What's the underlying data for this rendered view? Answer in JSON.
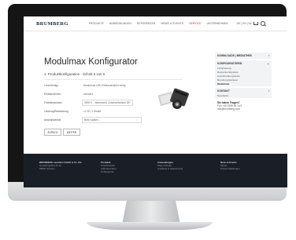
{
  "header": {
    "logo": "BRUMBERG",
    "nav": [
      "PRODUKTE",
      "ANWENDUNGEN",
      "REFERENZEN",
      "NEWS & EVENTS",
      "SERVICE",
      "UNTERNEHMEN"
    ],
    "active_nav": "SERVICE",
    "languages": "DE | EN | NL"
  },
  "page": {
    "title": "Modulmax Konfigurator",
    "step": "1. Produktkonfiguration - Schritt 6 von 6"
  },
  "form": {
    "rows": [
      {
        "label": "Leuchtentyp",
        "value": "Modulmax LED-Einbaustrahler eckig",
        "boxed": false
      },
      {
        "label": "Einbaurahmen",
        "value": "schwarz",
        "boxed": false
      },
      {
        "label": "Farbtemperatur",
        "value": "3000 K - Warmweiß | Abstrahlwinkel 38°",
        "boxed": true
      },
      {
        "label": "Leistung/Bestückung",
        "value": "12 W | 1 Modul",
        "boxed": false
      },
      {
        "label": "Abstrahlwinkel",
        "value": "Bitte wählen...",
        "boxed": true
      }
    ],
    "back_label": "ZURÜCK",
    "next_label": "WEITER"
  },
  "sidebar": {
    "groups": [
      {
        "title": "DOWNLOADS | MEDIATHEK",
        "items": []
      },
      {
        "title": "KONFIGURATOREN",
        "items": [
          "Lichtplanung",
          "Deckenkonfigurator",
          "Ausschreibungstexte",
          "Brumberg Extranet",
          "Modulmax"
        ],
        "active": "Modulmax"
      },
      {
        "title": "KONTAKT",
        "items": [
          "Newsletter"
        ]
      }
    ],
    "contact_title": "Sie haben Fragen?",
    "contact_phone": "Fon +49 2935 96 14 0",
    "contact_email": "info@brumberg.com"
  },
  "footer": {
    "columns": [
      {
        "title": "BRUMBERG Leuchten GmbH & Co. KG",
        "lines": [
          "Gewerbegebiet 10-12",
          "59846 Sundern"
        ]
      },
      {
        "title": "Produkte",
        "lines": [
          "Innenleuchten",
          "Außenleuchten",
          "Lichtsysteme"
        ]
      },
      {
        "title": "Anwendungen",
        "lines": [
          "Shop & Retail",
          "Hotellerie & Gastronomie"
        ]
      },
      {
        "title": "News & Events",
        "lines": [
          "Messe",
          "Pressemitteilungen"
        ]
      }
    ]
  },
  "colors": {
    "accent": "#cc2222",
    "footer_bg": "#1a1f27"
  }
}
